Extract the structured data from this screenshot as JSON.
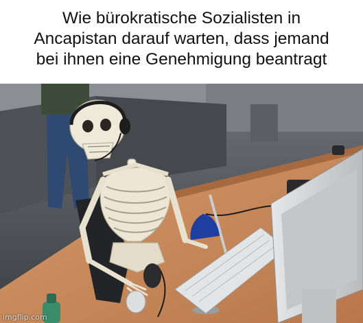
{
  "meme": {
    "caption": "Wie bürokratische Sozialisten in\nAncapistan darauf warten, dass jemand\nbei ihnen eine Genehmigung beantragt",
    "watermark": "imgflip.com"
  },
  "colors": {
    "caption_background": "#ffffff",
    "caption_text": "#111111",
    "desk": "#c8885a",
    "monitor": "#d5d6d7",
    "partition": "#4b4e53",
    "lamp": "#1e3ea0"
  },
  "icons": [
    "skeleton-figure",
    "desk-lamp-icon",
    "computer-monitor-icon",
    "keyboard-icon",
    "mouse-icon",
    "bottle-icon",
    "headset-icon"
  ]
}
